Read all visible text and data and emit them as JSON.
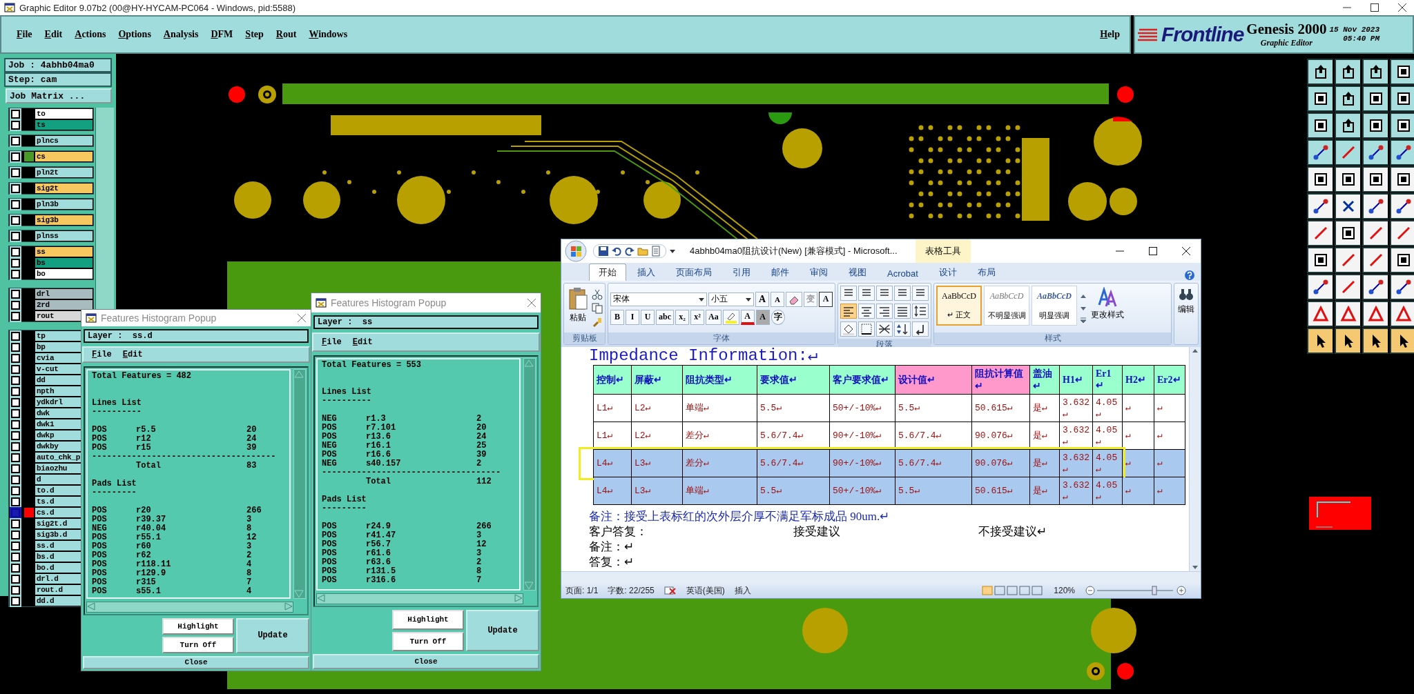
{
  "window": {
    "title": "Graphic Editor 9.07b2 (00@HY-HYCAM-PC064 - Windows, pid:5588)"
  },
  "menu": [
    {
      "label": "File"
    },
    {
      "label": "Edit"
    },
    {
      "label": "Actions"
    },
    {
      "label": "Options"
    },
    {
      "label": "Analysis"
    },
    {
      "label": "DFM"
    },
    {
      "label": "Step"
    },
    {
      "label": "Rout"
    },
    {
      "label": "Windows"
    }
  ],
  "help": "Help",
  "branding": {
    "logo": "Frontline",
    "product": "Genesis 2000",
    "subtitle": "Graphic Editor",
    "date": "15 Nov 2023",
    "time": "05:40 PM"
  },
  "job_panel": {
    "job": "Job : 4abhb04ma0",
    "step": "Step: cam",
    "matrix_button": "Job Matrix ...",
    "layer_groups": [
      {
        "layers": [
          {
            "name": "to",
            "color": "#ffffff",
            "affected": false
          },
          {
            "name": "ts",
            "color": "#12a080",
            "affected": false
          }
        ]
      },
      {
        "layers": [
          {
            "name": "plncs",
            "color": "#a0dcdc",
            "affected": false
          }
        ]
      },
      {
        "layers": [
          {
            "name": "cs",
            "color": "#f8c860",
            "affected": false,
            "swatch": {
              "color": "#4a9a2a"
            }
          }
        ]
      },
      {
        "layers": [
          {
            "name": "pln2t",
            "color": "#a0dcdc",
            "affected": false
          }
        ]
      },
      {
        "layers": [
          {
            "name": "sig2t",
            "color": "#f8c860",
            "affected": false
          }
        ]
      },
      {
        "layers": [
          {
            "name": "pln3b",
            "color": "#a0dcdc",
            "affected": false
          }
        ]
      },
      {
        "layers": [
          {
            "name": "sig3b",
            "color": "#f8c860",
            "affected": false
          }
        ]
      },
      {
        "layers": [
          {
            "name": "plnss",
            "color": "#a0dcdc",
            "affected": false
          }
        ]
      },
      {
        "layers": [
          {
            "name": "ss",
            "color": "#f8c860",
            "affected": false
          },
          {
            "name": "bs",
            "color": "#12a080",
            "affected": false
          },
          {
            "name": "bo",
            "color": "#ffffff",
            "affected": false
          }
        ]
      },
      {
        "layers": [
          {
            "name": "drl",
            "color": "#a8bcc0",
            "affected": false
          },
          {
            "name": "2rd",
            "color": "#a8bcc0",
            "affected": false
          },
          {
            "name": "rout",
            "color": "#d8d8d8",
            "affected": false
          }
        ]
      },
      {
        "layers": [
          {
            "name": "tp",
            "color": "#a0dcdc",
            "affected": false
          },
          {
            "name": "bp",
            "color": "#a0dcdc",
            "affected": false
          },
          {
            "name": "cvia",
            "color": "#a0dcdc",
            "affected": false
          },
          {
            "name": "v-cut",
            "color": "#a0dcdc",
            "affected": false
          },
          {
            "name": "dd",
            "color": "#a0dcdc",
            "affected": false
          },
          {
            "name": "npth",
            "color": "#a0dcdc",
            "affected": false
          },
          {
            "name": "ydkdrl",
            "color": "#a0dcdc",
            "affected": false
          },
          {
            "name": "dwk",
            "color": "#a0dcdc",
            "affected": false
          },
          {
            "name": "dwk1",
            "color": "#a0dcdc",
            "affected": false
          },
          {
            "name": "dwkp",
            "color": "#a0dcdc",
            "affected": false
          },
          {
            "name": "dwkby",
            "color": "#a0dcdc",
            "affected": false
          },
          {
            "name": "auto_chk_p",
            "color": "#a0dcdc",
            "affected": false
          },
          {
            "name": "biaozhu",
            "color": "#a0dcdc",
            "affected": false
          },
          {
            "name": "d",
            "color": "#a0dcdc",
            "affected": false
          },
          {
            "name": "to.d",
            "color": "#a0dcdc",
            "affected": false
          },
          {
            "name": "ts.d",
            "color": "#a0dcdc",
            "affected": false
          },
          {
            "name": "cs.d",
            "color": "#a0dcdc",
            "affected": true,
            "swatch": {
              "color": "#ff0000"
            }
          },
          {
            "name": "sig2t.d",
            "color": "#a0dcdc",
            "affected": false
          },
          {
            "name": "sig3b.d",
            "color": "#a0dcdc",
            "affected": false
          },
          {
            "name": "ss.d",
            "color": "#a0dcdc",
            "affected": false
          },
          {
            "name": "bs.d",
            "color": "#a0dcdc",
            "affected": false
          },
          {
            "name": "bo.d",
            "color": "#a0dcdc",
            "affected": false
          },
          {
            "name": "drl.d",
            "color": "#a0dcdc",
            "affected": false
          },
          {
            "name": "rout.d",
            "color": "#a0dcdc",
            "affected": false
          },
          {
            "name": "dd.d",
            "color": "#a0dcdc",
            "affected": false
          }
        ]
      }
    ]
  },
  "histogram_popups": [
    {
      "title": "Features Histogram Popup",
      "layer_label": "Layer :",
      "layer": "ss.d",
      "menu": [
        "File",
        "Edit"
      ],
      "summary": "Total Features = 482",
      "sections": [
        {
          "heading": "Lines List",
          "rule": "----------",
          "rows": [
            {
              "polarity": "POS",
              "symbol": "r5.5",
              "count": "20"
            },
            {
              "polarity": "POS",
              "symbol": "r12",
              "count": "24"
            },
            {
              "polarity": "POS",
              "symbol": "r15",
              "count": "39"
            }
          ],
          "total_rule": "-------------------------------------",
          "total_label": "Total",
          "total": "83"
        },
        {
          "heading": "Pads List",
          "rule": "---------",
          "rows": [
            {
              "polarity": "POS",
              "symbol": "r20",
              "count": "266"
            },
            {
              "polarity": "POS",
              "symbol": "r39.37",
              "count": "3"
            },
            {
              "polarity": "NEG",
              "symbol": "r40.04",
              "count": "8"
            },
            {
              "polarity": "POS",
              "symbol": "r55.1",
              "count": "12"
            },
            {
              "polarity": "POS",
              "symbol": "r60",
              "count": "3"
            },
            {
              "polarity": "POS",
              "symbol": "r62",
              "count": "2"
            },
            {
              "polarity": "POS",
              "symbol": "r118.11",
              "count": "4"
            },
            {
              "polarity": "POS",
              "symbol": "r129.9",
              "count": "8"
            },
            {
              "polarity": "POS",
              "symbol": "r315",
              "count": "7"
            },
            {
              "polarity": "POS",
              "symbol": "s55.1",
              "count": "4"
            }
          ]
        }
      ],
      "buttons": {
        "highlight": "Highlight",
        "turn_off": "Turn Off",
        "update": "Update",
        "close": "Close"
      }
    },
    {
      "title": "Features Histogram Popup",
      "layer_label": "Layer :",
      "layer": "ss",
      "menu": [
        "File",
        "Edit"
      ],
      "summary": "Total Features = 553",
      "sections": [
        {
          "heading": "Lines List",
          "rule": "----------",
          "rows": [
            {
              "polarity": "NEG",
              "symbol": "r1.3",
              "count": "2"
            },
            {
              "polarity": "POS",
              "symbol": "r7.101",
              "count": "20"
            },
            {
              "polarity": "POS",
              "symbol": "r13.6",
              "count": "24"
            },
            {
              "polarity": "NEG",
              "symbol": "r16.1",
              "count": "25"
            },
            {
              "polarity": "POS",
              "symbol": "r16.6",
              "count": "39"
            },
            {
              "polarity": "NEG",
              "symbol": "s40.157",
              "count": "2"
            }
          ],
          "total_rule": "------------------------------------",
          "total_label": "Total",
          "total": "112"
        },
        {
          "heading": "Pads List",
          "rule": "---------",
          "rows": [
            {
              "polarity": "POS",
              "symbol": "r24.9",
              "count": "266"
            },
            {
              "polarity": "POS",
              "symbol": "r41.47",
              "count": "3"
            },
            {
              "polarity": "POS",
              "symbol": "r56.7",
              "count": "12"
            },
            {
              "polarity": "POS",
              "symbol": "r61.6",
              "count": "3"
            },
            {
              "polarity": "POS",
              "symbol": "r63.6",
              "count": "2"
            },
            {
              "polarity": "POS",
              "symbol": "r131.5",
              "count": "8"
            },
            {
              "polarity": "POS",
              "symbol": "r316.6",
              "count": "7"
            }
          ]
        }
      ],
      "buttons": {
        "highlight": "Highlight",
        "turn_off": "Turn Off",
        "update": "Update",
        "close": "Close"
      }
    }
  ],
  "word": {
    "title": "4abhb04ma0阻抗设计(New) [兼容模式] - Microsoft...",
    "context_tab": "表格工具",
    "tabs": [
      {
        "label": "开始",
        "selected": true
      },
      {
        "label": "插入",
        "selected": false
      },
      {
        "label": "页面布局",
        "selected": false
      },
      {
        "label": "引用",
        "selected": false
      },
      {
        "label": "邮件",
        "selected": false
      },
      {
        "label": "审阅",
        "selected": false
      },
      {
        "label": "视图",
        "selected": false
      },
      {
        "label": "Acrobat",
        "selected": false
      },
      {
        "label": "设计",
        "selected": false
      },
      {
        "label": "布局",
        "selected": false
      }
    ],
    "ribbon": {
      "clipboard": {
        "paste": "粘贴",
        "label": "剪贴板"
      },
      "font": {
        "name": "宋体",
        "size": "小五",
        "size_buttons": [
          "A",
          "A"
        ],
        "extra_buttons": [
          "变",
          "A"
        ],
        "format_buttons": [
          "B",
          "I",
          "U",
          "abc",
          "x₂",
          "x²",
          "Aa"
        ],
        "color_buttons": [
          "A",
          "A",
          "字"
        ],
        "label": "字体"
      },
      "paragraph": {
        "alignments": [
          {
            "selected": true
          },
          {
            "selected": false
          },
          {
            "selected": false
          },
          {
            "selected": false
          }
        ],
        "label": "段落"
      },
      "styles": {
        "items": [
          {
            "sample": "AaBbCcD",
            "name": "↵ 正文",
            "selected": true
          },
          {
            "sample": "AaBbCcD",
            "name": "不明显强调",
            "selected": false
          },
          {
            "sample": "AaBbCcD",
            "name": "明显强调",
            "selected": false
          }
        ],
        "change": "更改样式",
        "label": "样式"
      },
      "editing": {
        "label": "编辑"
      }
    },
    "document": {
      "heading": "Impedance Information:↵",
      "table": {
        "columns": [
          {
            "label": "控制↵",
            "color": "#99ffcc"
          },
          {
            "label": "屏蔽↵",
            "color": "#99ffcc"
          },
          {
            "label": "阻抗类型↵",
            "color": "#99ffcc"
          },
          {
            "label": "要求值↵",
            "color": "#99ffcc"
          },
          {
            "label": "客户要求值↵",
            "color": "#99ffcc"
          },
          {
            "label": "设计值↵",
            "color": "#ff99cc"
          },
          {
            "label": "阻抗计算值↵",
            "color": "#ff99cc"
          },
          {
            "label": "盖油↵",
            "color": "#99ffcc"
          },
          {
            "label": "H1↵",
            "color": "#99ffcc"
          },
          {
            "label": "Er1↵",
            "color": "#99ffcc"
          },
          {
            "label": "H2↵",
            "color": "#99ffcc"
          },
          {
            "label": "Er2↵",
            "color": "#99ffcc"
          }
        ],
        "rows": [
          {
            "selected": false,
            "outlined": false,
            "cells": [
              "L1↵",
              "L2↵",
              "单端↵",
              "5.5↵",
              "50+/-10%↵",
              "5.5↵",
              "50.615↵",
              "是↵",
              "3.632↵",
              "4.05↵",
              "↵",
              "↵"
            ]
          },
          {
            "selected": false,
            "outlined": false,
            "cells": [
              "L1↵",
              "L2↵",
              "差分↵",
              "5.6/7.4↵",
              "90+/-10%↵",
              "5.6/7.4↵",
              "90.076↵",
              "是↵",
              "3.632↵",
              "4.05↵",
              "↵",
              "↵"
            ]
          },
          {
            "selected": true,
            "outlined": true,
            "cells": [
              "L4↵",
              "L3↵",
              "差分↵",
              "5.6/7.4↵",
              "90+/-10%↵",
              "5.6/7.4↵",
              "90.076↵",
              "是↵",
              "3.632↵",
              "4.05↵",
              "↵",
              "↵"
            ]
          },
          {
            "selected": true,
            "outlined": false,
            "cells": [
              "L4↵",
              "L3↵",
              "单端↵",
              "5.5↵",
              "50+/-10%↵",
              "5.5↵",
              "50.615↵",
              "是↵",
              "3.632↵",
              "4.05↵",
              "↵",
              "↵"
            ]
          }
        ]
      },
      "note": "备注：接受上表标红的次外层介厚不满足军标成品 90um.↵",
      "reply": {
        "label": "客户答复：",
        "accept": "接受建议",
        "reject": "不接受建议↵"
      },
      "lines": [
        "备注：↵",
        "答复：↵"
      ]
    },
    "status_bar": {
      "page": "页面: 1/1",
      "words": "字数: 22/255",
      "language": "英语(美国)",
      "mode": "插入",
      "zoom": "120%"
    }
  }
}
